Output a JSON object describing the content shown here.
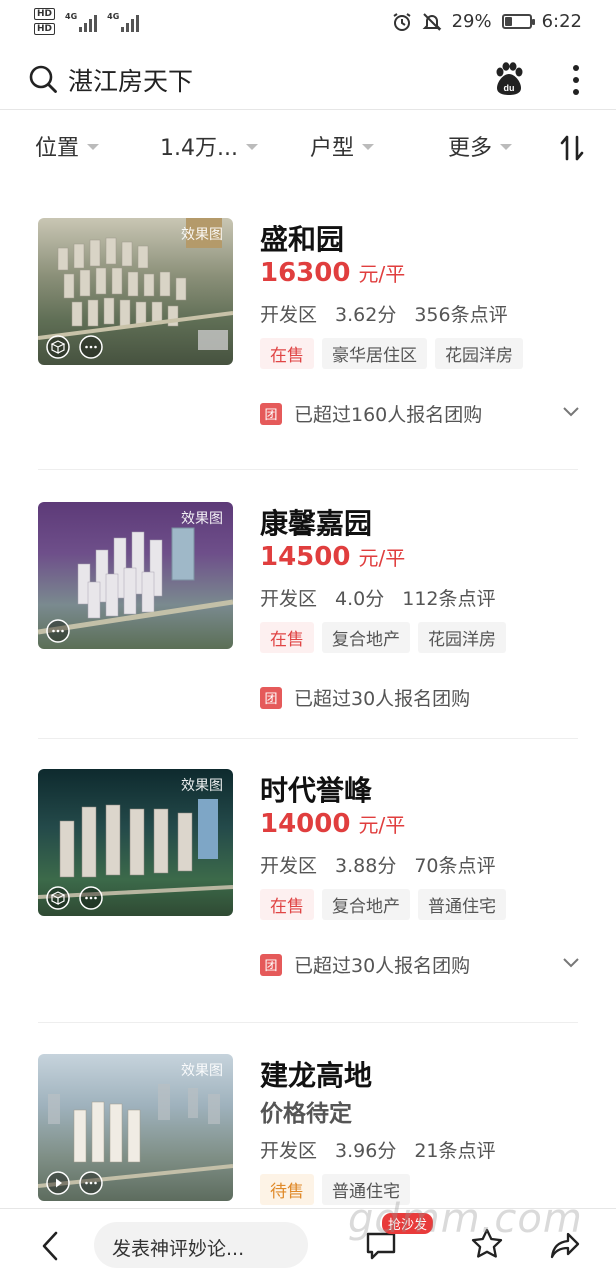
{
  "status_bar": {
    "hd1": "HD",
    "hd2": "HD",
    "net1": "4G",
    "net2": "4G",
    "battery_percent": "29%",
    "battery_level": 0.29,
    "time": "6:22"
  },
  "header": {
    "title": "湛江房天下",
    "icons": [
      "search-icon",
      "baidu-paw-icon",
      "more-vertical-icon"
    ]
  },
  "filters": [
    {
      "label": "位置"
    },
    {
      "label": "1.4万..."
    },
    {
      "label": "户型"
    },
    {
      "label": "更多"
    }
  ],
  "listings": [
    {
      "name": "盛和园",
      "price": "16300",
      "unit": "元/平",
      "district": "开发区",
      "score": "3.62分",
      "reviews": "356条点评",
      "tags": [
        "在售",
        "豪华居住区",
        "花园洋房"
      ],
      "image_tag": "效果图",
      "group_icon": "团",
      "group_text": "已超过160人报名团购"
    },
    {
      "name": "康馨嘉园",
      "price": "14500",
      "unit": "元/平",
      "district": "开发区",
      "score": "4.0分",
      "reviews": "112条点评",
      "tags": [
        "在售",
        "复合地产",
        "花园洋房"
      ],
      "image_tag": "效果图",
      "group_icon": "团",
      "group_text": "已超过30人报名团购"
    },
    {
      "name": "时代誉峰",
      "price": "14000",
      "unit": "元/平",
      "district": "开发区",
      "score": "3.88分",
      "reviews": "70条点评",
      "tags": [
        "在售",
        "复合地产",
        "普通住宅"
      ],
      "image_tag": "效果图",
      "group_icon": "团",
      "group_text": "已超过30人报名团购"
    },
    {
      "name": "建龙高地",
      "price_text": "价格待定",
      "district": "开发区",
      "score": "3.96分",
      "reviews": "21条点评",
      "tags": [
        "待售",
        "普通住宅"
      ],
      "image_tag": "效果图"
    }
  ],
  "bottom_bar": {
    "comment_placeholder": "发表神评妙论...",
    "badge": "抢沙发",
    "watermark": "gdmm.com"
  },
  "colors": {
    "price_red": "#e03e3e",
    "on_sale_bg": "#fdf0f0",
    "pending_orange": "#e08a2a"
  }
}
